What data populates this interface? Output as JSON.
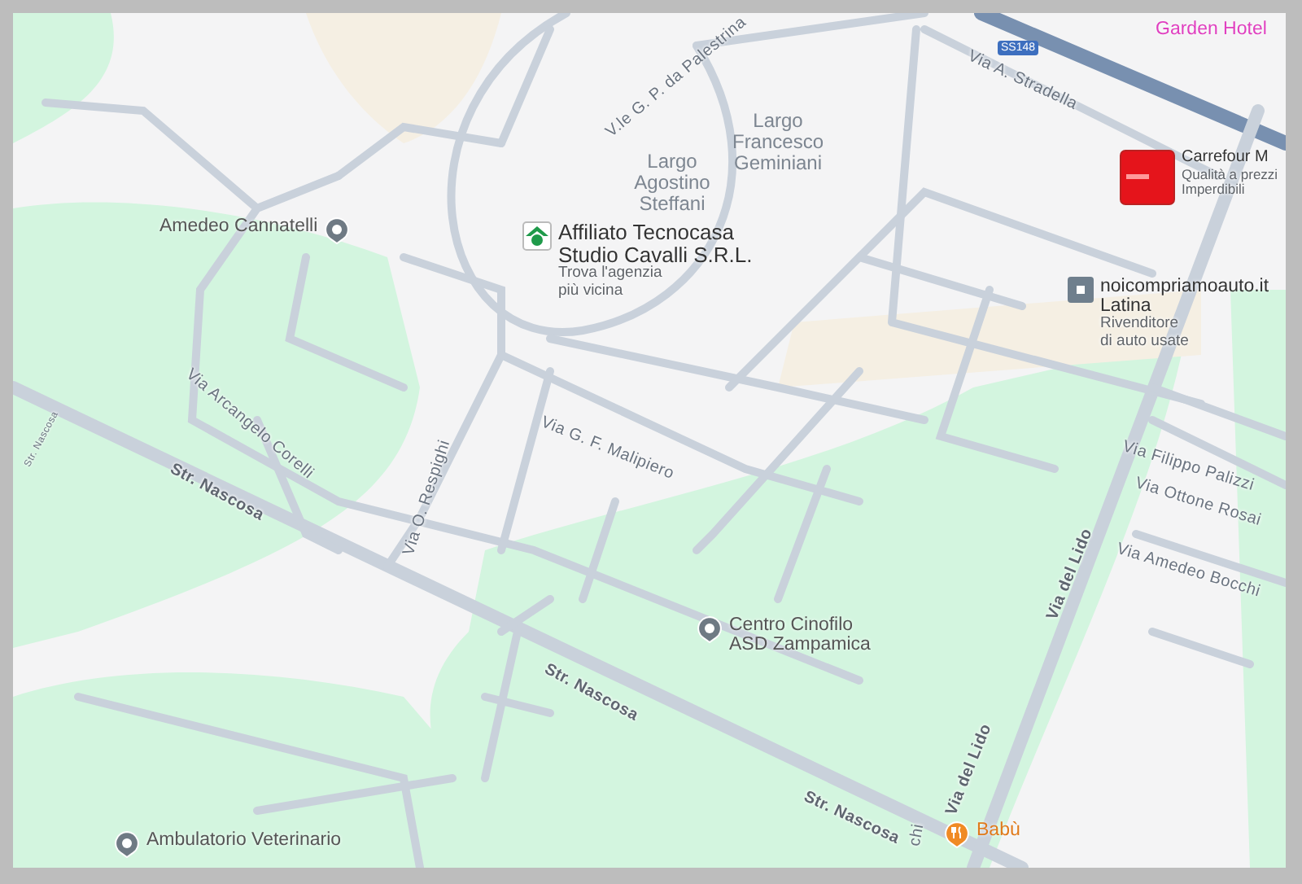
{
  "map": {
    "road_shield": "SS148",
    "areas": [
      {
        "lines": [
          "Largo",
          "Francesco",
          "Geminiani"
        ]
      },
      {
        "lines": [
          "Largo",
          "Agostino",
          "Steffani"
        ]
      }
    ],
    "streets": [
      {
        "name": "V.le G. P. da Palestrina",
        "major": false
      },
      {
        "name": "Via A. Stradella",
        "major": false
      },
      {
        "name": "Via Arcangelo Corelli",
        "major": false
      },
      {
        "name": "Str. Nascosa",
        "major": true
      },
      {
        "name": "Str. Nascosa",
        "major": true
      },
      {
        "name": "Str. Nascosa",
        "major": true
      },
      {
        "name": "Str. Nascosa",
        "major": false
      },
      {
        "name": "Via G. F. Malipiero",
        "major": false
      },
      {
        "name": "Via O. Respighi",
        "major": false
      },
      {
        "name": "Via del Lido",
        "major": true
      },
      {
        "name": "Via del Lido",
        "major": true
      },
      {
        "name": "Via Filippo Palizzi",
        "major": false
      },
      {
        "name": "Via Ottone Rosai",
        "major": false
      },
      {
        "name": "Via Amedeo Bocchi",
        "major": false
      },
      {
        "name": "chi",
        "major": false
      }
    ],
    "places": [
      {
        "kind": "hotel",
        "lines": [
          "Garden Hotel"
        ]
      },
      {
        "kind": "store",
        "lines": [
          "Carrefour M"
        ],
        "note": [
          "Qualità a prezzi",
          "Imperdibili"
        ]
      },
      {
        "kind": "agency",
        "lines": [
          "Affiliato Tecnocasa",
          "Studio Cavalli S.R.L."
        ],
        "note": [
          "Trova l'agenzia",
          "più vicina"
        ]
      },
      {
        "kind": "pin",
        "lines": [
          "Amedeo Cannatelli"
        ]
      },
      {
        "kind": "shop",
        "lines": [
          "noicompriamoauto.it",
          "Latina"
        ],
        "note": [
          "Rivenditore",
          "di auto usate"
        ]
      },
      {
        "kind": "pin",
        "lines": [
          "Centro Cinofilo",
          "ASD Zampamica"
        ]
      },
      {
        "kind": "restaurant",
        "lines": [
          "Babù"
        ]
      },
      {
        "kind": "pin",
        "lines": [
          "Ambulatorio Veterinario"
        ]
      }
    ]
  }
}
